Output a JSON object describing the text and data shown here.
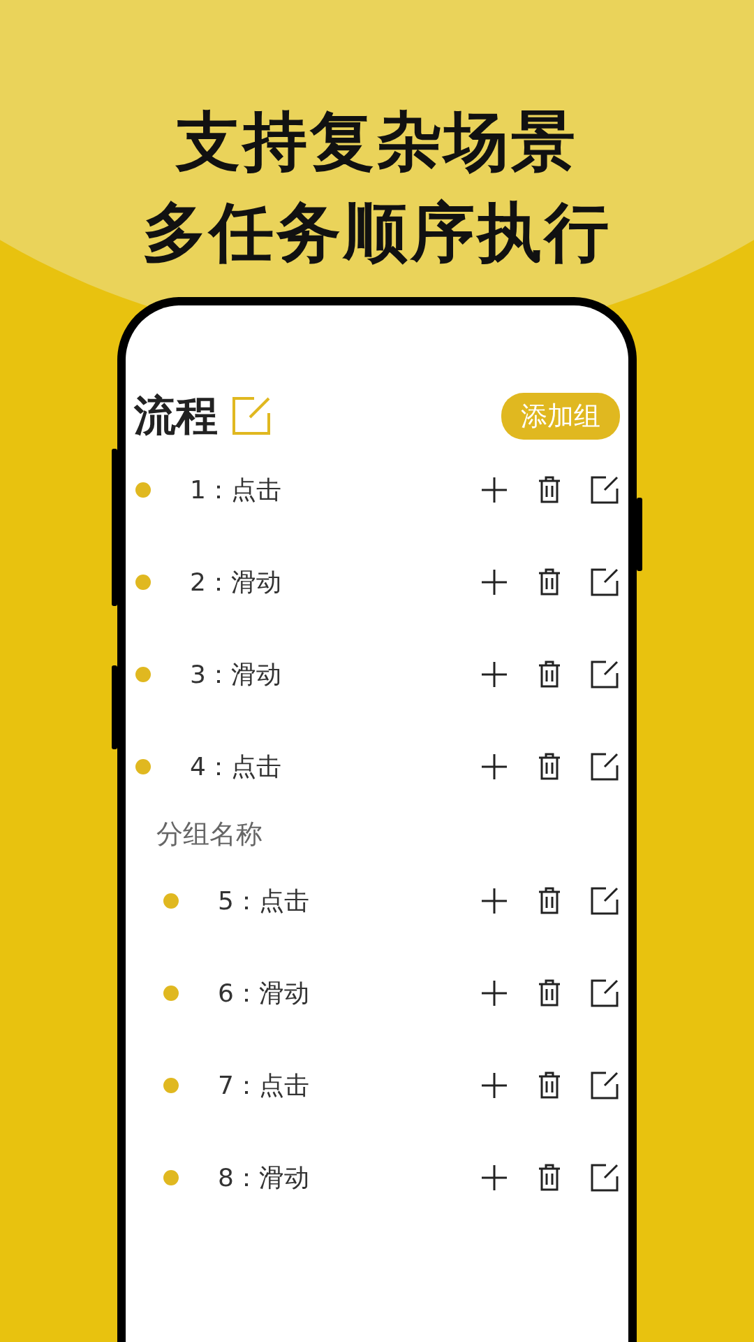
{
  "headline": [
    "支持复杂场景",
    "多任务顺序执行"
  ],
  "header": {
    "title": "流程",
    "add_group_button": "添加组"
  },
  "steps": [
    {
      "label": "1：点击"
    },
    {
      "label": "2：滑动"
    },
    {
      "label": "3：滑动"
    },
    {
      "label": "4：点击"
    }
  ],
  "group": {
    "name": "分组名称",
    "children": [
      {
        "label": "5：点击"
      },
      {
        "label": "6：滑动"
      },
      {
        "label": "7：点击"
      },
      {
        "label": "8：滑动"
      }
    ]
  }
}
